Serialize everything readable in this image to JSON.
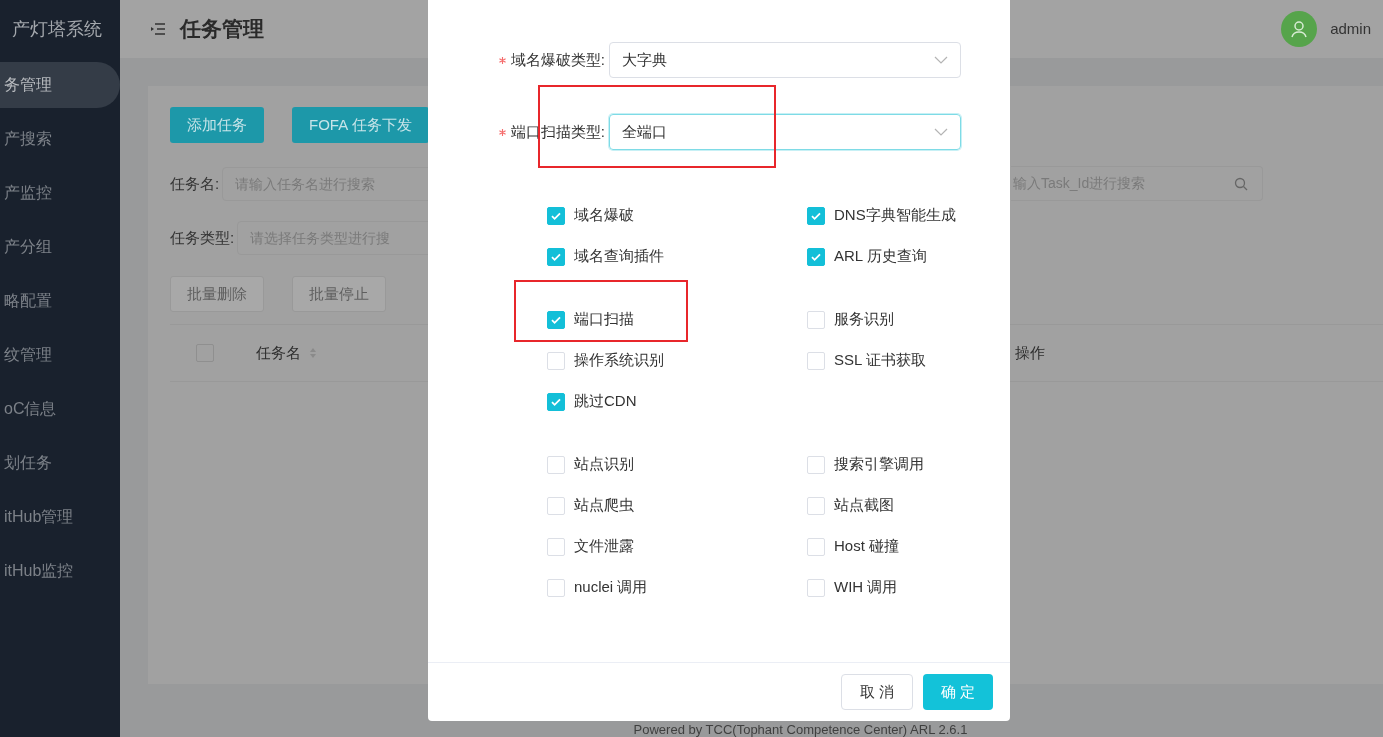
{
  "sidebar": {
    "title": "产灯塔系统",
    "items": [
      {
        "label": "务管理",
        "selected": true
      },
      {
        "label": "产搜索",
        "selected": false
      },
      {
        "label": "产监控",
        "selected": false
      },
      {
        "label": "产分组",
        "selected": false
      },
      {
        "label": "略配置",
        "selected": false
      },
      {
        "label": "纹管理",
        "selected": false
      },
      {
        "label": "oC信息",
        "selected": false
      },
      {
        "label": "划任务",
        "selected": false
      },
      {
        "label": "itHub管理",
        "selected": false
      },
      {
        "label": "itHub监控",
        "selected": false
      }
    ]
  },
  "header": {
    "title": "任务管理",
    "user": "admin"
  },
  "actions": [
    "添加任务",
    "FOFA 任务下发"
  ],
  "filters": [
    {
      "label": "任务名:",
      "placeholder": "请输入任务名进行搜索"
    },
    {
      "label": "任务类型:",
      "placeholder": "请选择任务类型进行搜"
    }
  ],
  "task_id_search": {
    "placeholder": "输入Task_Id进行搜索"
  },
  "batch_buttons": [
    {
      "label": "批量删除",
      "disabled": true
    },
    {
      "label": "批量停止",
      "disabled": true
    }
  ],
  "table": {
    "select_all": {
      "checked": false
    },
    "columns": [
      "任务名",
      "操作"
    ]
  },
  "footer": "Powered by TCC(Tophant Competence Center) ARL 2.6.1",
  "dialog": {
    "fields": [
      {
        "label": "域名爆破类型:",
        "value": "大字典",
        "required": true,
        "focused": false
      },
      {
        "label": "端口扫描类型:",
        "value": "全端口",
        "required": true,
        "focused": true
      }
    ],
    "option_groups": [
      {
        "options": [
          {
            "label": "域名爆破",
            "checked": true
          },
          {
            "label": "DNS字典智能生成",
            "checked": true
          },
          {
            "label": "域名查询插件",
            "checked": true
          },
          {
            "label": "ARL 历史查询",
            "checked": true
          }
        ]
      },
      {
        "options": [
          {
            "label": "端口扫描",
            "checked": true
          },
          {
            "label": "服务识别",
            "checked": false
          },
          {
            "label": "操作系统识别",
            "checked": false
          },
          {
            "label": "SSL 证书获取",
            "checked": false
          },
          {
            "label": "跳过CDN",
            "checked": true
          }
        ]
      },
      {
        "options": [
          {
            "label": "站点识别",
            "checked": false
          },
          {
            "label": "搜索引擎调用",
            "checked": false
          },
          {
            "label": "站点爬虫",
            "checked": false
          },
          {
            "label": "站点截图",
            "checked": false
          },
          {
            "label": "文件泄露",
            "checked": false
          },
          {
            "label": "Host 碰撞",
            "checked": false
          },
          {
            "label": "nuclei 调用",
            "checked": false
          },
          {
            "label": "WIH 调用",
            "checked": false
          }
        ]
      }
    ],
    "buttons": [
      {
        "label": "取 消",
        "kind": "default"
      },
      {
        "label": "确 定",
        "kind": "primary"
      }
    ]
  }
}
